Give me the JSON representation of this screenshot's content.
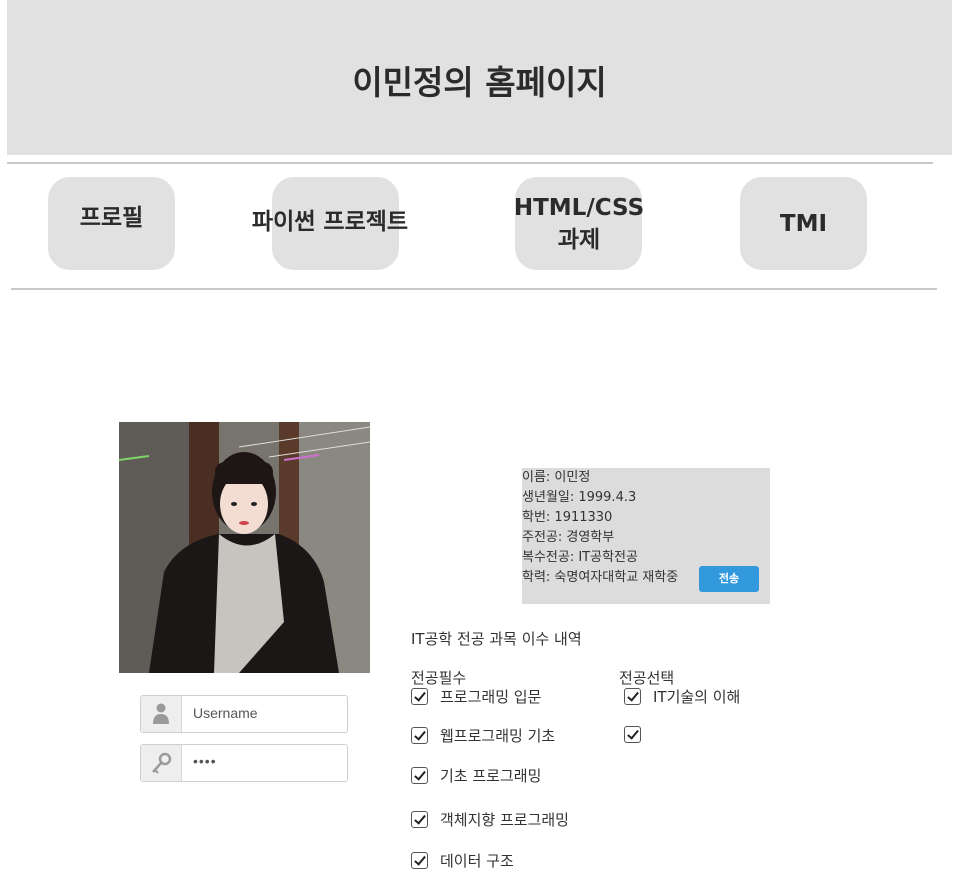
{
  "header": {
    "title": "이민정의 홈페이지"
  },
  "nav": {
    "profile": "프로필",
    "python_project": "파이썬 프로젝트",
    "html_css_line1": "HTML/CSS",
    "html_css_line2": "과제",
    "tmi": "TMI"
  },
  "login": {
    "username_placeholder": "Username",
    "password_value": "••••"
  },
  "profile_info": {
    "name": "이름: 이민정",
    "birth": "생년월일: 1999.4.3",
    "student_id": "학번: 1911330",
    "major": "주전공: 경영학부",
    "double_major": "복수전공: IT공학전공",
    "education": "학력: 숙명여자대학교 재학중",
    "send_label": "전송"
  },
  "courses": {
    "title": "IT공학 전공 과목 이수 내역",
    "required_heading": "전공필수",
    "elective_heading": "전공선택",
    "required": [
      "프로그래밍 입문",
      "웹프로그래밍 기초",
      "기초 프로그래밍",
      "객체지향 프로그래밍",
      "데이터 구조"
    ],
    "elective": [
      "IT기술의 이해",
      ""
    ]
  }
}
